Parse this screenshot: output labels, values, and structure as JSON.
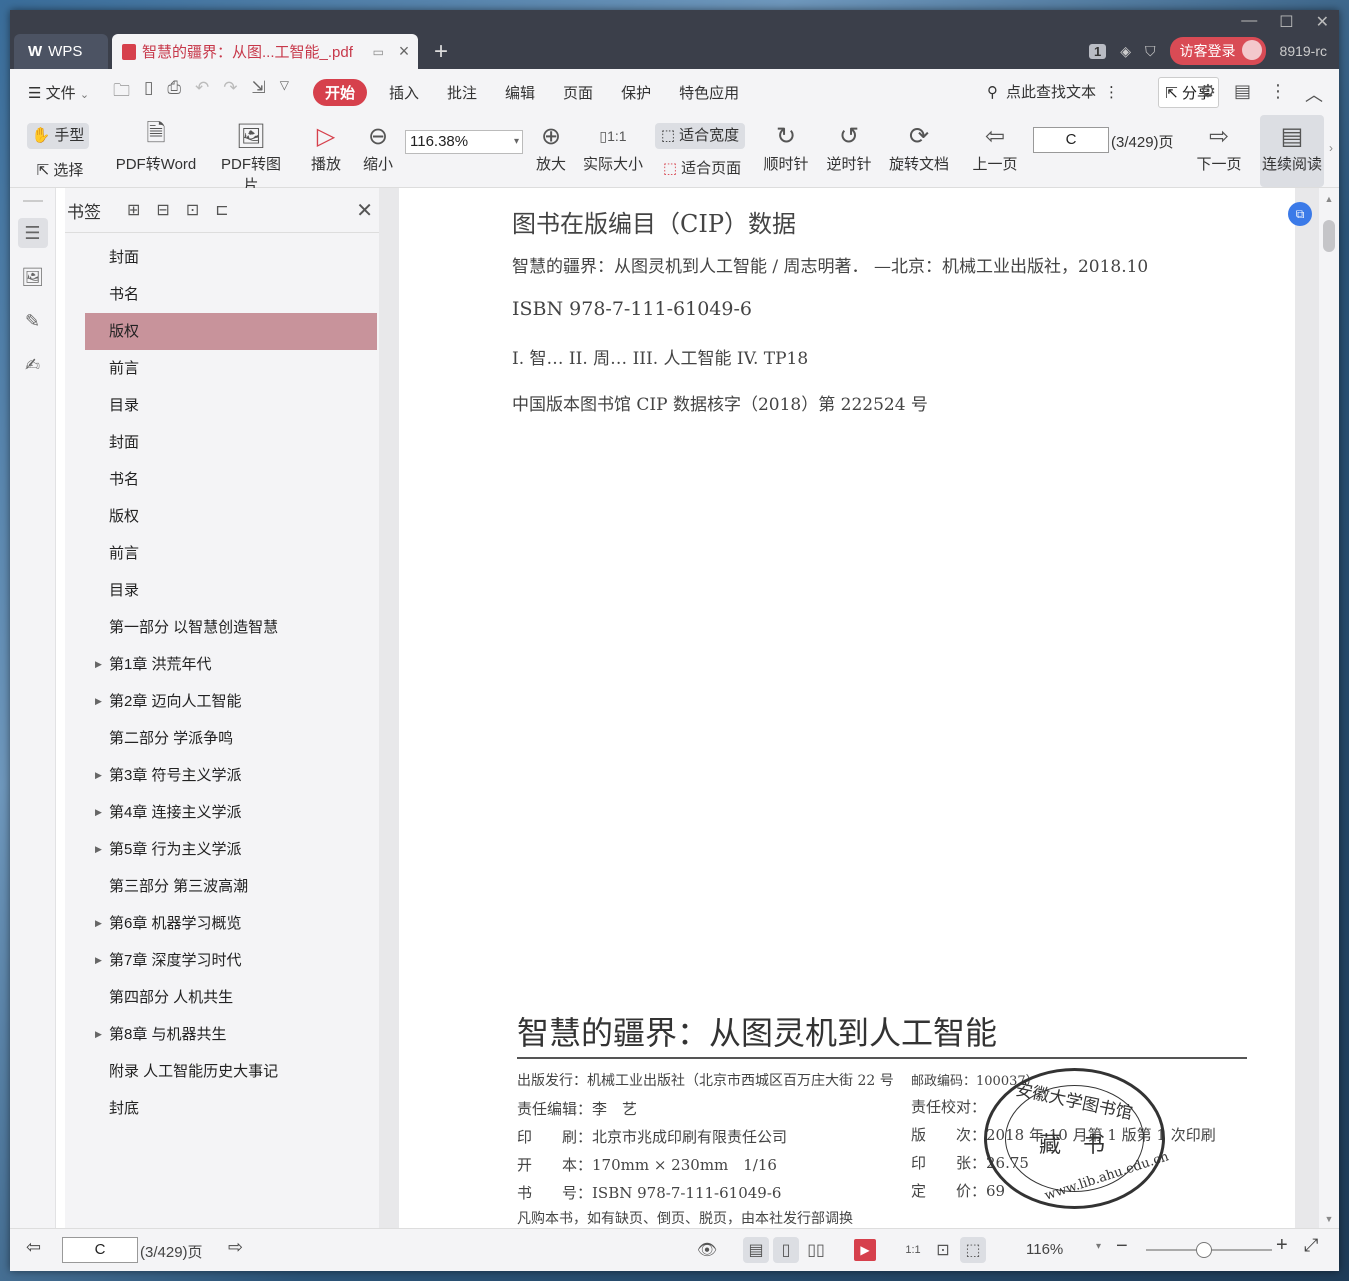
{
  "titlebar": {
    "app_tab": "WPS",
    "doc_tab": "智慧的疆界：从图...工智能_.pdf",
    "page_count_badge": "1",
    "login_button": "访客登录",
    "version": "8919-rc"
  },
  "menubar": {
    "file": "文件",
    "items": [
      "开始",
      "插入",
      "批注",
      "编辑",
      "页面",
      "保护",
      "特色应用"
    ],
    "search_placeholder": "点此查找文本",
    "share": "分享"
  },
  "toolbar": {
    "hand": "手型",
    "select": "选择",
    "pdf_to_word": "PDF转Word",
    "pdf_to_image": "PDF转图片",
    "play": "播放",
    "zoom_out": "缩小",
    "zoom_value": "116.38%",
    "zoom_in": "放大",
    "actual_size": "实际大小",
    "fit_width": "适合宽度",
    "fit_page": "适合页面",
    "clockwise": "顺时针",
    "counterclockwise": "逆时针",
    "rotate_doc": "旋转文档",
    "prev_page": "上一页",
    "page_input": "C",
    "page_info": "(3/429)页",
    "next_page": "下一页",
    "continuous": "连续阅读"
  },
  "bookmarks": {
    "title": "书签",
    "items": [
      {
        "label": "封面",
        "expandable": false
      },
      {
        "label": "书名",
        "expandable": false
      },
      {
        "label": "版权",
        "expandable": false,
        "selected": true
      },
      {
        "label": "前言",
        "expandable": false
      },
      {
        "label": "目录",
        "expandable": false
      },
      {
        "label": "封面",
        "expandable": false
      },
      {
        "label": "书名",
        "expandable": false
      },
      {
        "label": "版权",
        "expandable": false
      },
      {
        "label": "前言",
        "expandable": false
      },
      {
        "label": "目录",
        "expandable": false
      },
      {
        "label": "第一部分 以智慧创造智慧",
        "expandable": false
      },
      {
        "label": "第1章 洪荒年代",
        "expandable": true
      },
      {
        "label": "第2章 迈向人工智能",
        "expandable": true
      },
      {
        "label": "第二部分 学派争鸣",
        "expandable": false
      },
      {
        "label": "第3章 符号主义学派",
        "expandable": true
      },
      {
        "label": "第4章 连接主义学派",
        "expandable": true
      },
      {
        "label": "第5章 行为主义学派",
        "expandable": true
      },
      {
        "label": "第三部分 第三波高潮",
        "expandable": false
      },
      {
        "label": "第6章 机器学习概览",
        "expandable": true
      },
      {
        "label": "第7章 深度学习时代",
        "expandable": true
      },
      {
        "label": "第四部分 人机共生",
        "expandable": false
      },
      {
        "label": "第8章 与机器共生",
        "expandable": true
      },
      {
        "label": "附录 人工智能历史大事记",
        "expandable": false
      },
      {
        "label": "封底",
        "expandable": false
      }
    ]
  },
  "page": {
    "cip_title": "图书在版编目（CIP）数据",
    "cip_line1": "智慧的疆界：从图灵机到人工智能 / 周志明著． —北京：机械工业出版社，2018.10",
    "cip_line2": "ISBN 978-7-111-61049-6",
    "cip_line3": "I. 智…   II. 周…   III. 人工智能   IV. TP18",
    "cip_line4": "中国版本图书馆 CIP 数据核字（2018）第 222524 号",
    "book_title": "智慧的疆界：从图灵机到人工智能",
    "imprint": {
      "publisher": "出版发行：机械工业出版社（北京市西城区百万庄大街 22 号",
      "postcode": "邮政编码：100037）",
      "editor": "责任编辑：李　艺",
      "proofreader": "责任校对：",
      "printer": "印　　刷：北京市兆成印刷有限责任公司",
      "edition": "版　　次：2018 年 10 月第 1 版第 1 次印刷",
      "format": "开　　本：170mm × 230mm　1/16",
      "sheets": "印　　张：26.75",
      "isbn": "书　　号：ISBN 978-7-111-61049-6",
      "price": "定　　价：69",
      "notice": "凡购本书，如有缺页、倒页、脱页，由本社发行部调换"
    },
    "stamp": {
      "top": "安徽大学图书馆",
      "center": "藏　书",
      "bottom": "www.lib.ahu.edu.cn"
    }
  },
  "statusbar": {
    "page_input": "C",
    "page_info": "(3/429)页",
    "zoom": "116%"
  }
}
